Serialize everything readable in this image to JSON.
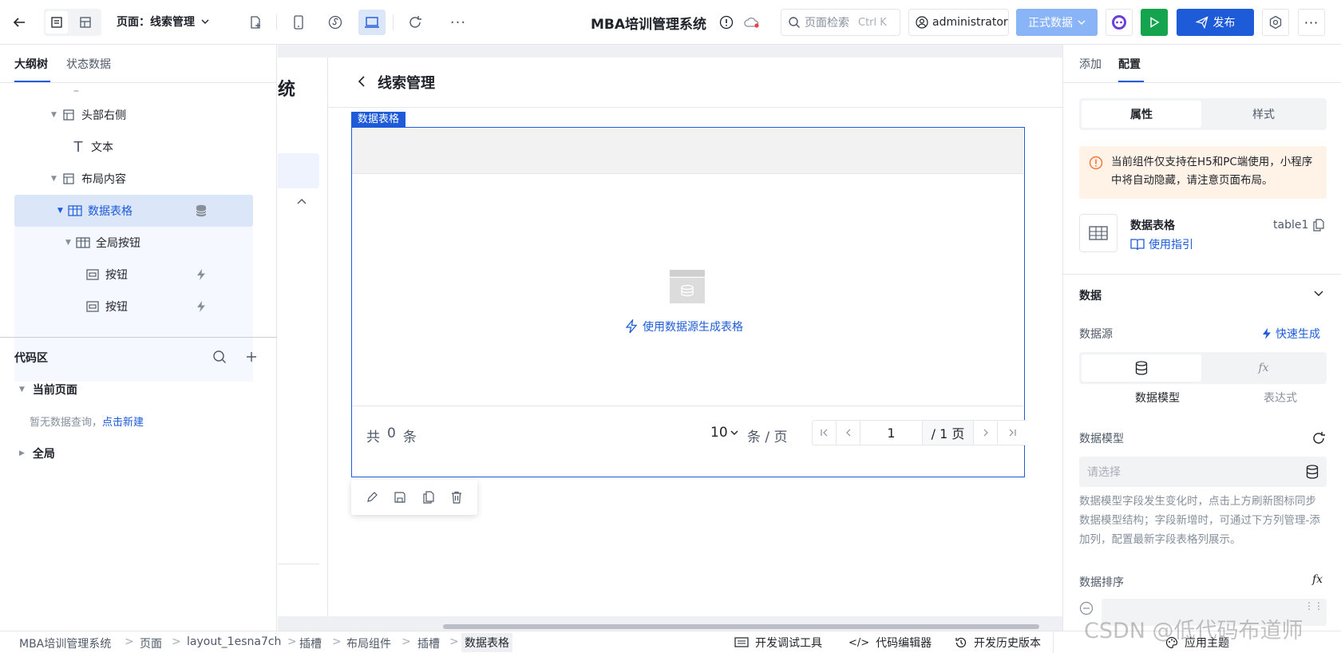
{
  "topbar": {
    "page_label": "页面：线索管理",
    "app_title": "MBA培训管理系统",
    "search_placeholder": "页面检索",
    "search_shortcut": "Ctrl K",
    "user": "administrator",
    "env_label": "正式数据",
    "publish_label": "发布"
  },
  "left": {
    "tabs": [
      "大纲树",
      "状态数据"
    ],
    "tree": [
      {
        "label": "–"
      },
      {
        "label": "头部右侧"
      },
      {
        "label": "文本"
      },
      {
        "label": "布局内容"
      },
      {
        "label": "数据表格"
      },
      {
        "label": "全局按钮"
      },
      {
        "label": "按钮"
      },
      {
        "label": "按钮"
      }
    ],
    "code_title": "代码区",
    "current_page": "当前页面",
    "empty_text": "暂无数据查询，",
    "create_link": "点击新建",
    "global_label": "全局"
  },
  "canvas": {
    "page_title": "线索管理",
    "comp_tag": "数据表格",
    "gen_link": "使用数据源生成表格",
    "total_prefix": "共",
    "total_count": "0",
    "total_suffix": "条",
    "page_size": "10",
    "page_unit": "条 / 页",
    "current_page": "1",
    "page_total": "/ 1 页",
    "side_title_fragment": "统"
  },
  "right": {
    "tabs": [
      "添加",
      "配置"
    ],
    "seg": [
      "属性",
      "样式"
    ],
    "notice": "当前组件仅支持在H5和PC端使用，小程序中将自动隐藏，请注意页面布局。",
    "comp_name": "数据表格",
    "comp_id": "table1",
    "guide": "使用指引",
    "section_data": "数据",
    "datasource_label": "数据源",
    "quick_gen": "快速生成",
    "src_options": [
      "数据模型",
      "表达式"
    ],
    "model_label": "数据模型",
    "model_placeholder": "请选择",
    "model_help": "数据模型字段发生变化时，点击上方刷新图标同步数据模型结构；字段新增时，可通过下方列管理-添加列，配置最新字段表格列展示。",
    "sort_label": "数据排序",
    "fx": "fx"
  },
  "bottombar": {
    "breadcrumbs": [
      "MBA培训管理系统",
      "页面",
      "layout_1esna7ch",
      "插槽",
      "布局组件",
      "插槽",
      "数据表格"
    ],
    "tools": [
      "开发调试工具",
      "代码编辑器",
      "开发历史版本",
      "应用主题"
    ]
  },
  "watermark": "CSDN @低代码布道师",
  "colors": {
    "primary": "#1d5bd8",
    "accent_green": "#14a44d",
    "env_btn": "#8ab4f8",
    "selected_bg": "#dbe6f9"
  }
}
